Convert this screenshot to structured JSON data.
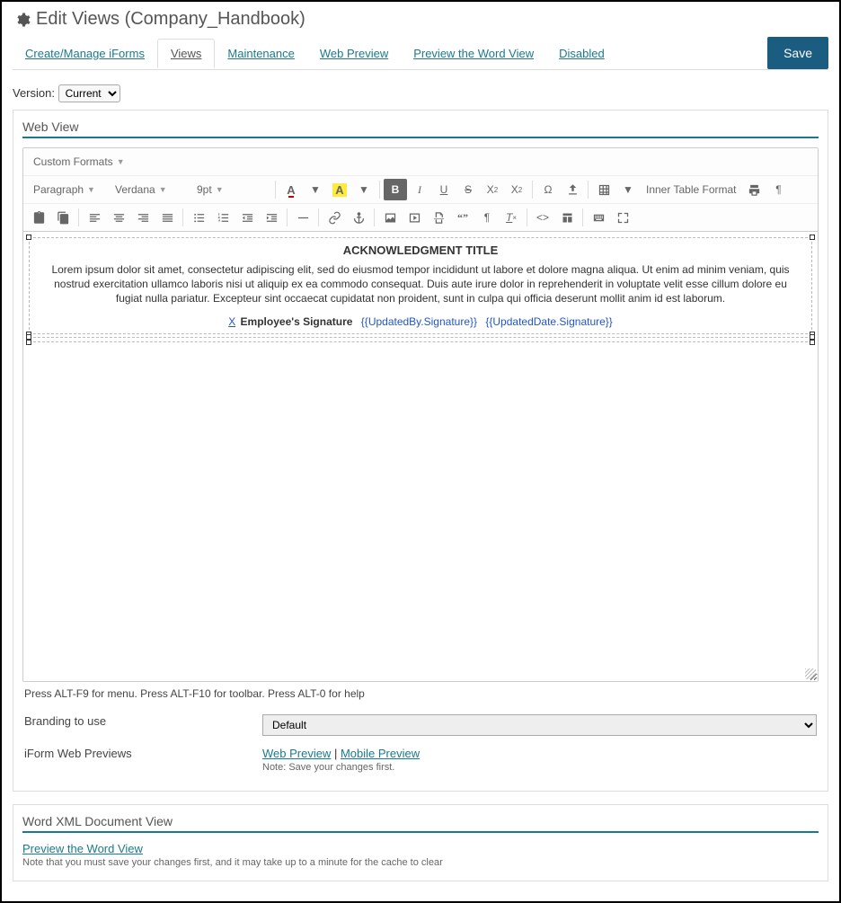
{
  "header": {
    "title": "Edit Views (Company_Handbook)"
  },
  "tabs": {
    "create_manage": "Create/Manage iForms",
    "views": "Views",
    "maintenance": "Maintenance",
    "web_preview": "Web Preview",
    "preview_word": "Preview the Word View",
    "disabled": "Disabled",
    "save": "Save"
  },
  "version": {
    "label": "Version:",
    "selected": "Current"
  },
  "webview": {
    "panel_title": "Web View",
    "custom_formats": "Custom Formats",
    "block_format": "Paragraph",
    "font_family": "Verdana",
    "font_size": "9pt",
    "inner_table_format": "Inner Table Format",
    "content": {
      "title": "ACKNOWLEDGMENT TITLE",
      "body": "Lorem ipsum dolor sit amet, consectetur adipiscing elit, sed do eiusmod tempor incididunt ut labore et dolore magna aliqua. Ut enim ad minim veniam, quis nostrud exercitation ullamco laboris nisi ut aliquip ex ea commodo consequat. Duis aute irure dolor in reprehenderit in voluptate velit esse cillum dolore eu fugiat nulla pariatur. Excepteur sint occaecat cupidatat non proident, sunt in culpa qui officia deserunt mollit anim id est laborum.",
      "sig_x": "X",
      "sig_label": "Employee's Signature",
      "sig_updatedby": "{{UpdatedBy.Signature}}",
      "sig_updateddate": "{{UpdatedDate.Signature}}"
    },
    "hint": "Press ALT-F9 for menu. Press ALT-F10 for toolbar. Press ALT-0 for help",
    "branding_label": "Branding to use",
    "branding_value": "Default",
    "previews_label": "iForm Web Previews",
    "web_preview_link": "Web Preview",
    "mobile_preview_link": "Mobile Preview",
    "previews_sep": " | ",
    "previews_note": "Note: Save your changes first."
  },
  "wordview": {
    "panel_title": "Word XML Document View",
    "link": "Preview the Word View",
    "note": "Note that you must save your changes first, and it may take up to a minute for the cache to clear"
  }
}
